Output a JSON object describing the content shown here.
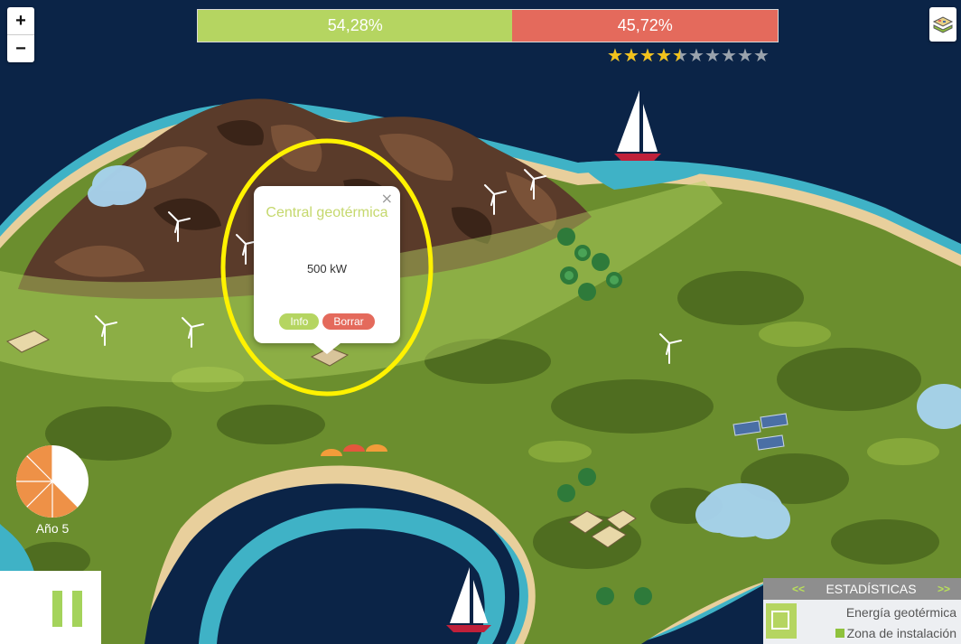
{
  "zoom": {
    "in_label": "+",
    "out_label": "−"
  },
  "energy_bar": {
    "green_label": "54,28%",
    "red_label": "45,72%",
    "green_fraction": 0.5428,
    "green_color": "#b5d561",
    "red_color": "#e46a5c"
  },
  "rating": {
    "value": 4.5,
    "max": 10,
    "filled_color": "#f2c21b",
    "empty_color": "#9aa3ad"
  },
  "layers_button": {
    "icon": "layers-icon"
  },
  "popup": {
    "title": "Central geotérmica",
    "power": "500 kW",
    "info_label": "Info",
    "delete_label": "Borrar",
    "close_label": "×"
  },
  "year": {
    "label": "Año 5",
    "progress": 0.375
  },
  "pause_button": {
    "icon": "pause-icon"
  },
  "stats_panel": {
    "header": "ESTADÍSTICAS",
    "prev_label": "<<",
    "next_label": ">>",
    "energy_label": "Energía geotérmica",
    "zone_label": "Zona de instalación"
  },
  "colors": {
    "sea": "#0b2447",
    "grass": "#6b8e2e",
    "accent_green": "#b5d561",
    "accent_red": "#e46a5c",
    "highlight": "#fff200"
  }
}
